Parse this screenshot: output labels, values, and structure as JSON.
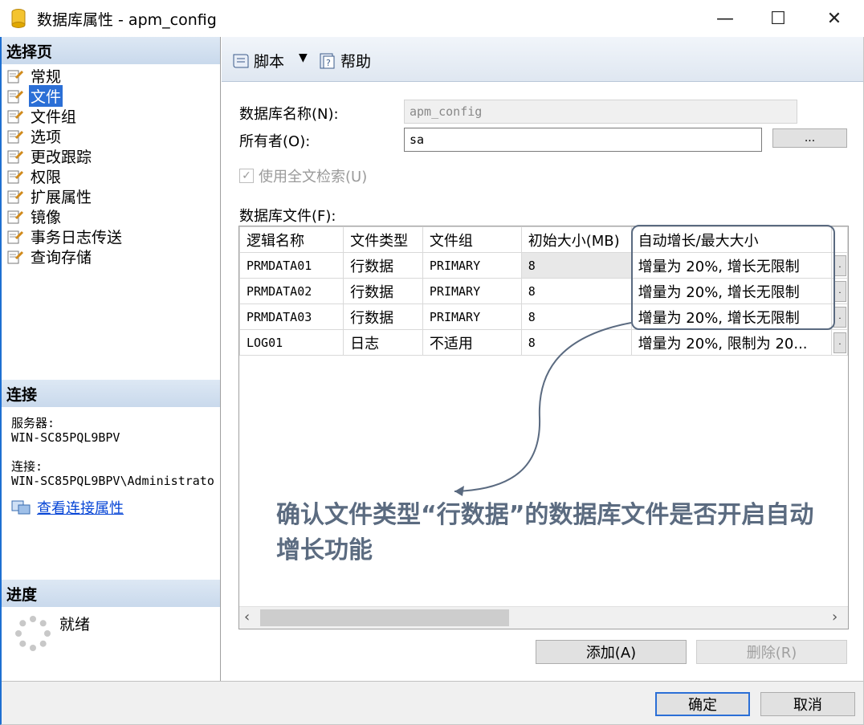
{
  "window": {
    "title": "数据库属性 - apm_config",
    "minimize_glyph": "—",
    "maximize_glyph": "☐",
    "close_glyph": "✕"
  },
  "sidebar": {
    "pages_header": "选择页",
    "items": [
      {
        "label": "常规",
        "selected": false
      },
      {
        "label": "文件",
        "selected": true
      },
      {
        "label": "文件组",
        "selected": false
      },
      {
        "label": "选项",
        "selected": false
      },
      {
        "label": "更改跟踪",
        "selected": false
      },
      {
        "label": "权限",
        "selected": false
      },
      {
        "label": "扩展属性",
        "selected": false
      },
      {
        "label": "镜像",
        "selected": false
      },
      {
        "label": "事务日志传送",
        "selected": false
      },
      {
        "label": "查询存储",
        "selected": false
      }
    ],
    "connection_header": "连接",
    "server_label": "服务器:",
    "server_value": "WIN-SC85PQL9BPV",
    "connection_label": "连接:",
    "connection_value": "WIN-SC85PQL9BPV\\Administrato",
    "view_connection_link": "查看连接属性",
    "progress_header": "进度",
    "progress_status": "就绪"
  },
  "toolbar": {
    "script_label": "脚本",
    "dropdown_glyph": "▼",
    "help_label": "帮助"
  },
  "form": {
    "db_name_label": "数据库名称(N):",
    "db_name_value": "apm_config",
    "owner_label": "所有者(O):",
    "owner_value": "sa",
    "browse_button": "...",
    "fulltext_label": "使用全文检索(U)",
    "fulltext_checked": true,
    "db_files_label": "数据库文件(F):"
  },
  "grid": {
    "columns": [
      "逻辑名称",
      "文件类型",
      "文件组",
      "初始大小(MB)",
      "自动增长/最大大小"
    ],
    "rows": [
      {
        "logical_name": "PRMDATA01",
        "file_type": "行数据",
        "filegroup": "PRIMARY",
        "initial_size": "8",
        "autogrowth": "增量为 20%, 增长无限制"
      },
      {
        "logical_name": "PRMDATA02",
        "file_type": "行数据",
        "filegroup": "PRIMARY",
        "initial_size": "8",
        "autogrowth": "增量为 20%, 增长无限制"
      },
      {
        "logical_name": "PRMDATA03",
        "file_type": "行数据",
        "filegroup": "PRIMARY",
        "initial_size": "8",
        "autogrowth": "增量为 20%, 增长无限制"
      },
      {
        "logical_name": "LOG01",
        "file_type": "日志",
        "filegroup": "不适用",
        "initial_size": "8",
        "autogrowth": "增量为 20%, 限制为 20..."
      }
    ],
    "browse_glyph": "."
  },
  "buttons": {
    "add": "添加(A)",
    "remove": "删除(R)",
    "ok": "确定",
    "cancel": "取消"
  },
  "annotation": {
    "text": "确认文件类型“行数据”的数据库文件是否开启自动增长功能"
  },
  "colors": {
    "accent": "#2b6fd6",
    "annotation": "#5b6b80",
    "link": "#0645d6"
  }
}
